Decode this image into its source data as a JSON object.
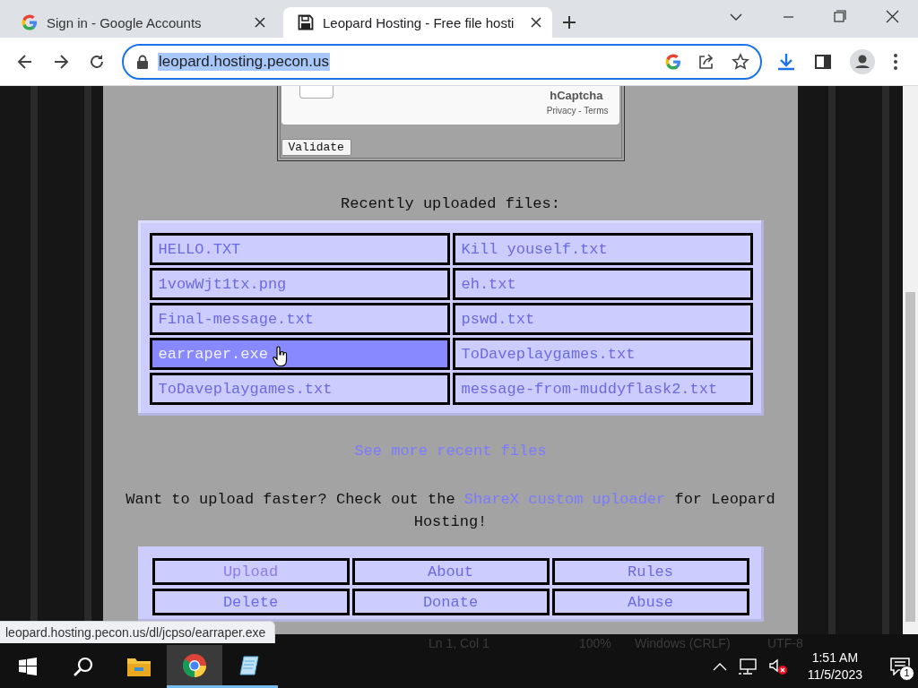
{
  "browser": {
    "tabs": [
      {
        "title": "Sign in - Google Accounts",
        "kind": "google",
        "selected": false
      },
      {
        "title": "Leopard Hosting - Free file hosti",
        "kind": "floppy",
        "selected": true
      }
    ],
    "address": "leopard.hosting.pecon.us"
  },
  "captcha": {
    "checked": false,
    "brand": "hCaptcha",
    "links": "Privacy - Terms",
    "button": "Validate"
  },
  "recent": {
    "heading": "Recently uploaded files:",
    "files": [
      {
        "name": "HELLO.TXT",
        "selected": false
      },
      {
        "name": "Kill youself.txt",
        "selected": false
      },
      {
        "name": "1vowWjt1tx.png",
        "selected": false
      },
      {
        "name": "eh.txt",
        "selected": false
      },
      {
        "name": "Final-message.txt",
        "selected": false
      },
      {
        "name": "pswd.txt",
        "selected": false
      },
      {
        "name": "earraper.exe",
        "selected": true
      },
      {
        "name": "ToDaveplaygames.txt",
        "selected": false
      },
      {
        "name": "ToDaveplaygames.txt",
        "selected": false
      },
      {
        "name": "message-from-muddyflask2.txt",
        "selected": false
      }
    ],
    "more_link": "See more recent files"
  },
  "promo": {
    "before": "Want to upload faster? Check out the ",
    "link": "ShareX custom uploader",
    "after": " for Leopard Hosting!"
  },
  "nav": [
    {
      "label": "Upload",
      "visited": true
    },
    {
      "label": "About",
      "visited": false
    },
    {
      "label": "Rules",
      "visited": false
    },
    {
      "label": "Delete",
      "visited": false
    },
    {
      "label": "Donate",
      "visited": false
    },
    {
      "label": "Abuse",
      "visited": false
    }
  ],
  "status_url": "leopard.hosting.pecon.us/dl/jcpso/earraper.exe",
  "background_window": {
    "status": [
      "Ln 1, Col 1",
      "100%",
      "Windows (CRLF)",
      "UTF-8"
    ]
  },
  "taskbar": {
    "time": "1:51 AM",
    "date": "11/5/2023",
    "notifications": "1"
  }
}
